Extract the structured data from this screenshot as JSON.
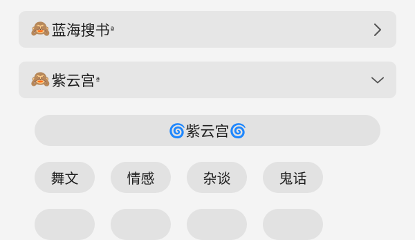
{
  "sections": [
    {
      "emoji": "🙈",
      "title": "蓝海搜书",
      "sup": "ª",
      "chevron": "chevron-right-icon"
    },
    {
      "emoji": "🙈",
      "title": "紫云宫",
      "sup": "ª",
      "chevron": "chevron-down-icon"
    }
  ],
  "banner": {
    "icon": "🌀",
    "label": "紫云宫"
  },
  "tags": [
    "舞文",
    "情感",
    "杂谈",
    "鬼话",
    "",
    "",
    "",
    ""
  ]
}
